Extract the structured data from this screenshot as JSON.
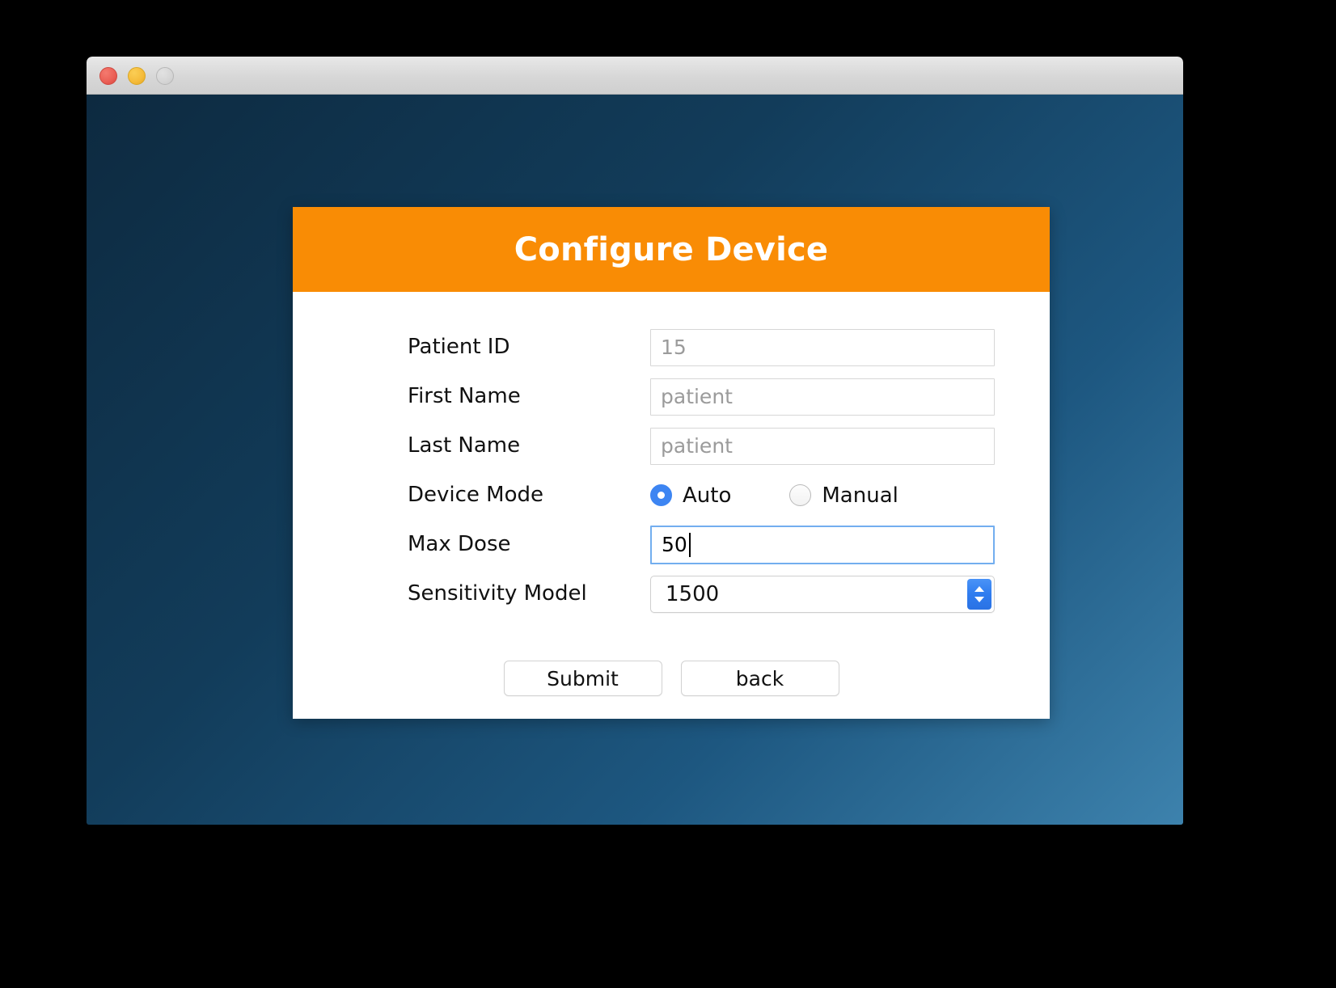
{
  "window": {
    "traffic_lights": [
      {
        "name": "close",
        "color": "#ea5f55"
      },
      {
        "name": "minimize",
        "color": "#f5bb3a"
      },
      {
        "name": "zoom",
        "color": "#d5d5d5"
      }
    ],
    "background_gradient_from": "#0d2a40",
    "background_gradient_to": "#3d82ad"
  },
  "dialog": {
    "title": "Configure Device",
    "header_color": "#f98c05",
    "accent_color": "#3d85f2",
    "fields": [
      {
        "label": "Patient ID",
        "type": "text",
        "value": "",
        "placeholder": "15",
        "focused": false
      },
      {
        "label": "First Name",
        "type": "text",
        "value": "",
        "placeholder": "patient",
        "focused": false
      },
      {
        "label": "Last Name",
        "type": "text",
        "value": "",
        "placeholder": "patient",
        "focused": false
      },
      {
        "label": "Device Mode",
        "type": "radio",
        "options": [
          {
            "label": "Auto",
            "selected": true
          },
          {
            "label": "Manual",
            "selected": false
          }
        ]
      },
      {
        "label": "Max Dose",
        "type": "text",
        "value": "50",
        "placeholder": "",
        "focused": true
      },
      {
        "label": "Sensitivity Model",
        "type": "select",
        "value": "1500",
        "options": [
          "1500"
        ]
      }
    ],
    "buttons": [
      {
        "label": "Submit"
      },
      {
        "label": "back"
      }
    ]
  }
}
